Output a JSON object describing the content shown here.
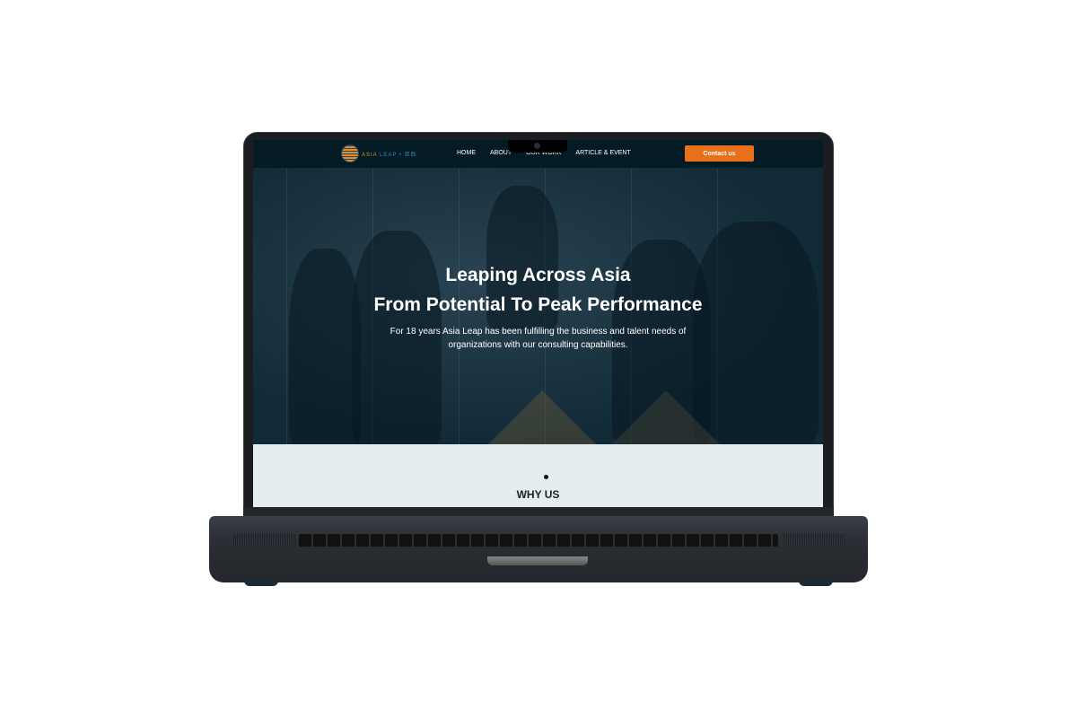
{
  "brand": {
    "name": "ASIA LEAP",
    "chinese": "亚跃"
  },
  "nav": {
    "items": [
      "HOME",
      "ABOUT",
      "OUR WORK",
      "ARTICLE & EVENT"
    ],
    "cta": "Contact us"
  },
  "hero": {
    "title_line1": "Leaping Across Asia",
    "title_line2": "From Potential To Peak Performance",
    "subtitle": "For 18 years Asia Leap has been fulfilling the business and talent needs of organizations with our consulting capabilities."
  },
  "section": {
    "title": "WHY US"
  },
  "colors": {
    "accent": "#e8701a",
    "nav_bg": "#041b26",
    "section_bg": "#e6edf1"
  }
}
